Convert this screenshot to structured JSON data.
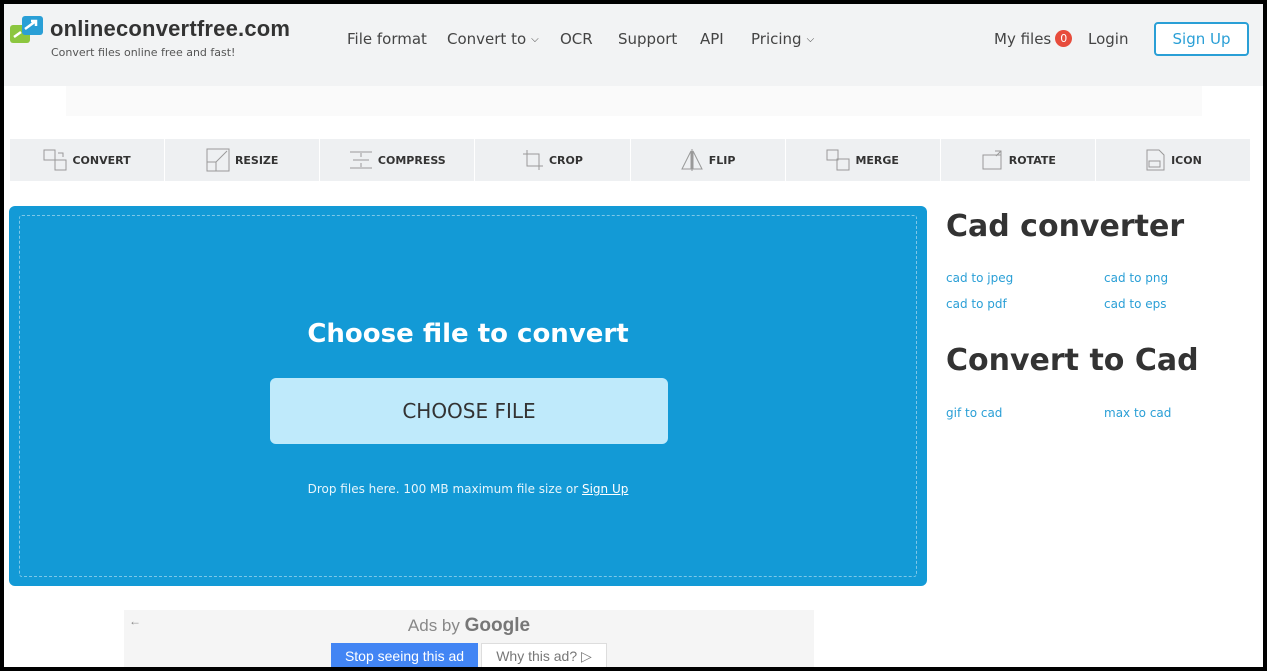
{
  "header": {
    "logo_title": "onlineconvertfree.com",
    "logo_subtitle": "Convert files online free and fast!",
    "nav": {
      "file_format": "File format",
      "convert_to": "Convert to",
      "ocr": "OCR",
      "support": "Support",
      "api": "API",
      "pricing": "Pricing"
    },
    "my_files": "My files",
    "my_files_count": "0",
    "login": "Login",
    "sign_up": "Sign Up"
  },
  "toolbar": {
    "convert": "CONVERT",
    "resize": "RESIZE",
    "compress": "COMPRESS",
    "crop": "CROP",
    "flip": "FLIP",
    "merge": "MERGE",
    "rotate": "ROTATE",
    "icon": "ICON"
  },
  "dropzone": {
    "title": "Choose file to convert",
    "button": "CHOOSE FILE",
    "note": "Drop files here. 100 MB maximum file size or ",
    "note_link": "Sign Up"
  },
  "sidebar": {
    "heading1": "Cad converter",
    "links1": [
      "cad to jpeg",
      "cad to png",
      "cad to pdf",
      "cad to eps"
    ],
    "heading2": "Convert to Cad",
    "links2": [
      "gif to cad",
      "max to cad"
    ]
  },
  "ads": {
    "prefix": "Ads by",
    "brand": "Google",
    "stop": "Stop seeing this ad",
    "why": "Why this ad?"
  },
  "colors": {
    "accent": "#2a9fd6",
    "dropzone": "#139ad6",
    "choose_button": "#bfeafb",
    "badge": "#e74c3c"
  }
}
